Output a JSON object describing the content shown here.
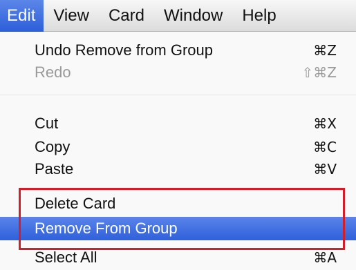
{
  "menubar": {
    "items": [
      {
        "label": "Edit",
        "active": true
      },
      {
        "label": "View"
      },
      {
        "label": "Card"
      },
      {
        "label": "Window"
      },
      {
        "label": "Help"
      }
    ]
  },
  "edit_menu": {
    "undo": {
      "label": "Undo Remove from Group",
      "shortcut": "⌘Z"
    },
    "redo": {
      "label": "Redo",
      "shortcut": "⇧⌘Z",
      "disabled": true
    },
    "cut": {
      "label": "Cut",
      "shortcut": "⌘X"
    },
    "copy": {
      "label": "Copy",
      "shortcut": "⌘C"
    },
    "paste": {
      "label": "Paste",
      "shortcut": "⌘V"
    },
    "delete_card": {
      "label": "Delete Card"
    },
    "remove_from_group": {
      "label": "Remove From Group",
      "highlighted": true
    },
    "select_all": {
      "label": "Select All",
      "shortcut": "⌘A"
    }
  },
  "colors": {
    "highlight": "#2f60db",
    "annotation": "#d21e2b"
  }
}
